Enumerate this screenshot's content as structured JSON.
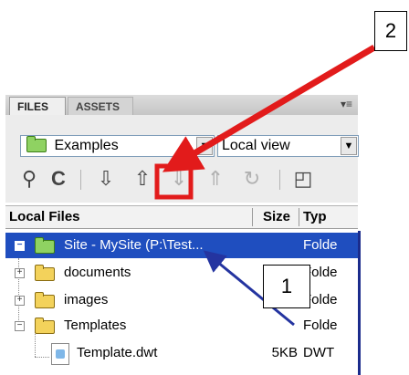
{
  "tabs": {
    "files": "FILES",
    "assets": "ASSETS",
    "menu": "▾≡"
  },
  "site_select": {
    "value": "Examples"
  },
  "view_select": {
    "value": "Local view"
  },
  "toolbar": {
    "connect": "⚲",
    "refresh": "C",
    "get": "⇩",
    "put": "⇧",
    "checkout": "⇓",
    "checkin": "⇑",
    "sync": "↻",
    "expand": "◰"
  },
  "columns": {
    "name": "Local Files",
    "size": "Size",
    "type": "Typ"
  },
  "tree": {
    "site": {
      "name": "Site - MySite (P:\\Test...",
      "type": "Folde"
    },
    "documents": {
      "name": "documents",
      "type": "Folde"
    },
    "images": {
      "name": "images",
      "type": "Folde"
    },
    "templates": {
      "name": "Templates",
      "type": "Folde"
    },
    "template_file": {
      "name": "Template.dwt",
      "size": "5KB",
      "type": "DWT"
    }
  },
  "callouts": {
    "one": "1",
    "two": "2"
  },
  "colors": {
    "highlight_red": "#e21b1b",
    "arrow_blue": "#2434a0",
    "selection": "#1f4ebf"
  }
}
